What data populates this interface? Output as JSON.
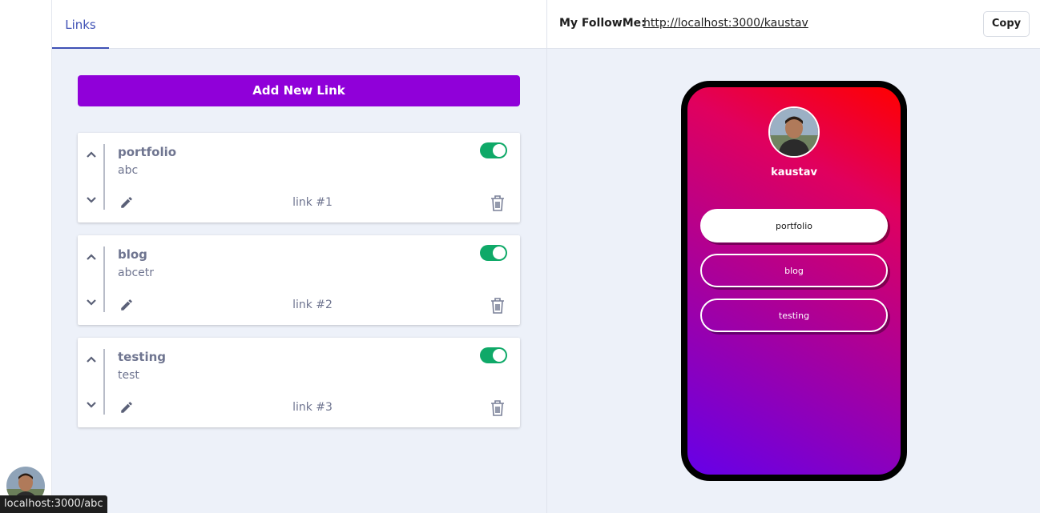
{
  "tabs": [
    {
      "label": "Links"
    }
  ],
  "add_button": {
    "label": "Add New Link"
  },
  "links": [
    {
      "title": "portfolio",
      "url": "abc",
      "number_label": "link #1",
      "enabled": true
    },
    {
      "title": "blog",
      "url": "abcetr",
      "number_label": "link #2",
      "enabled": true
    },
    {
      "title": "testing",
      "url": "test",
      "number_label": "link #3",
      "enabled": true
    }
  ],
  "header": {
    "followme_label": "My FollowMe:",
    "followme_url": "http://localhost:3000/kaustav",
    "copy_label": "Copy"
  },
  "preview": {
    "username": "kaustav",
    "buttons": [
      "portfolio",
      "blog",
      "testing"
    ]
  },
  "status_bar": {
    "text": "localhost:3000/abc"
  },
  "icons": [
    "chevron-up-icon",
    "chevron-down-icon",
    "pencil-icon",
    "trash-icon",
    "toggle-switch"
  ],
  "colors": {
    "accent": "#9000d9",
    "tab": "#3f51b5",
    "toggle_on": "#0fa968",
    "gradient_top": "#ff0000",
    "gradient_bottom": "#6600e8"
  }
}
